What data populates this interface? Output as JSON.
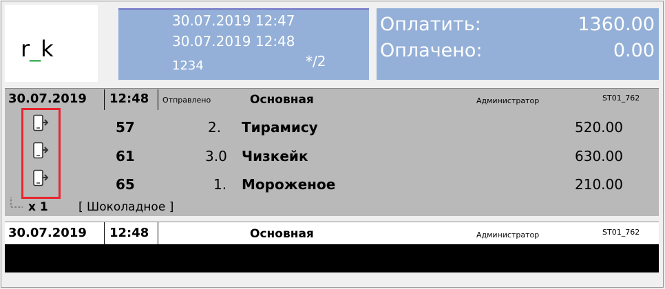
{
  "logo": {
    "before": "r",
    "underscore": "_",
    "after": "k"
  },
  "order_box": {
    "opened": "30.07.2019 12:47",
    "updated": "30.07.2019 12:48",
    "number": "1234",
    "guests": "*/2"
  },
  "payment": {
    "pay_label": "Оплатить:",
    "pay_value": "1360.00",
    "paid_label": "Оплачено:",
    "paid_value": "0.00"
  },
  "order_header": {
    "date": "30.07.2019",
    "time": "12:48",
    "status": "Отправлено",
    "section": "Основная",
    "role": "Администратор",
    "station": "ST01_762"
  },
  "items": [
    {
      "code": "57",
      "qty": "2.",
      "name": "Тирамису",
      "price": "520.00"
    },
    {
      "code": "61",
      "qty": "3.0",
      "name": "Чизкейк",
      "price": "630.00"
    },
    {
      "code": "65",
      "qty": "1.",
      "name": "Мороженое",
      "price": "210.00"
    }
  ],
  "modifier": {
    "multiplier": "x 1",
    "text": "[ Шоколадное ]"
  },
  "next_header": {
    "date": "30.07.2019",
    "time": "12:48",
    "section": "Основная",
    "role": "Администратор",
    "station": "ST01_762"
  },
  "icons": {
    "item_status": "phone-send-icon",
    "tree": "tree-branch-icon"
  },
  "colors": {
    "panel_blue": "#94b0d8",
    "highlight": "#e8242e",
    "logo_accent": "#2aa84a"
  }
}
